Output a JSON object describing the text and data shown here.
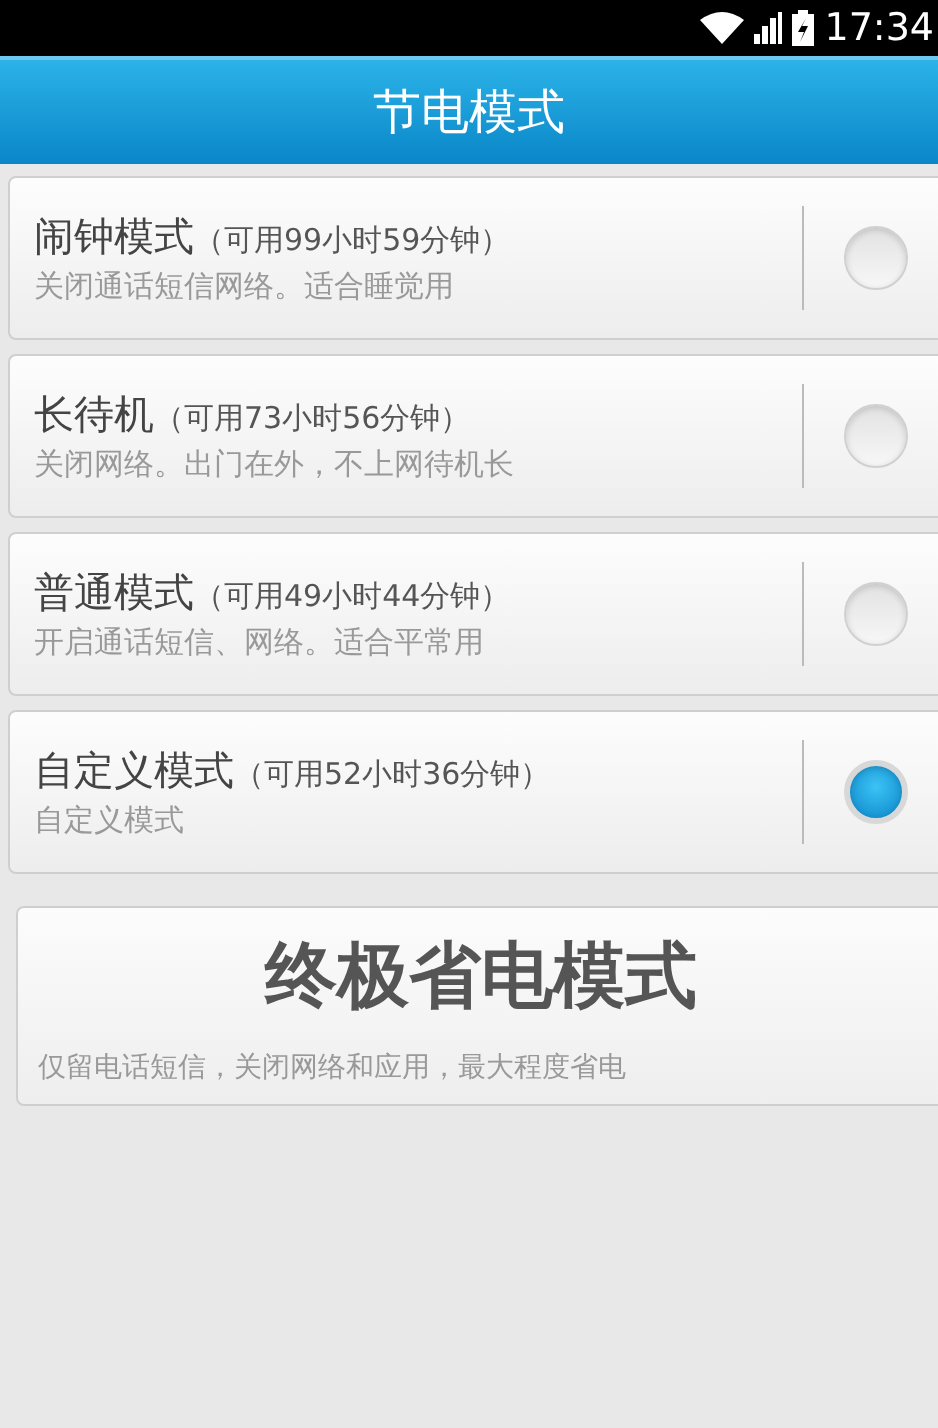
{
  "status_bar": {
    "time": "17:34"
  },
  "header": {
    "title": "节电模式"
  },
  "modes": [
    {
      "name": "闹钟模式",
      "availability": "（可用99小时59分钟）",
      "description": "关闭通话短信网络。适合睡觉用",
      "selected": false
    },
    {
      "name": "长待机",
      "availability": "（可用73小时56分钟）",
      "description": "关闭网络。出门在外，不上网待机长",
      "selected": false
    },
    {
      "name": "普通模式",
      "availability": "（可用49小时44分钟）",
      "description": "开启通话短信、网络。适合平常用",
      "selected": false
    },
    {
      "name": "自定义模式",
      "availability": "（可用52小时36分钟）",
      "description": "自定义模式",
      "selected": true
    }
  ],
  "ultimate": {
    "title": "终极省电模式",
    "description": "仅留电话短信，关闭网络和应用，最大程度省电"
  }
}
